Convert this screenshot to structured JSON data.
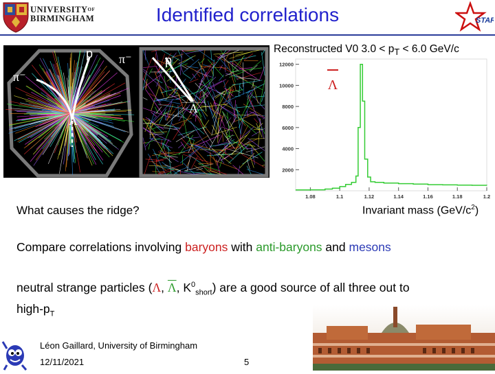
{
  "header": {
    "university_line1": "UNIVERSITY",
    "university_of": "OF",
    "university_line2": "BIRMINGHAM",
    "title": "Identified correlations"
  },
  "event_display": {
    "labels": {
      "p_left": "p",
      "pi_top": "π⁻",
      "pi_left": "π⁻",
      "lambda_left": "Λ",
      "p_right": "p",
      "lambda_right": "Λ"
    }
  },
  "histogram": {
    "caption": "Reconstructed V0 3.0 < pT < 6.0 GeV/c",
    "caption_parts": {
      "pre": "Reconstructed V0 3.0 < p",
      "sub": "T",
      "post": " < 6.0 GeV/c"
    },
    "marker": "Λ",
    "xlabel": "Invariant mass (GeV/c2)",
    "xlabel_parts": {
      "pre": "Invariant mass (GeV/c",
      "sup": "2",
      "post": ")"
    }
  },
  "chart_data": {
    "type": "line",
    "xlim": [
      1.07,
      1.2
    ],
    "ylim": [
      0,
      12500
    ],
    "xticks": [
      1.08,
      1.1,
      1.12,
      1.14,
      1.16,
      1.18,
      1.2
    ],
    "xtick_labels": [
      "1.08",
      "1.1",
      "1.12",
      "1.14",
      "1.16",
      "1.18",
      "1.2"
    ],
    "yticks": [
      2000,
      4000,
      6000,
      8000,
      10000,
      12000
    ],
    "ytick_labels": [
      "2000",
      "4000",
      "6000",
      "8000",
      "10000",
      "12000"
    ],
    "x": [
      1.07,
      1.08,
      1.09,
      1.095,
      1.1,
      1.104,
      1.108,
      1.111,
      1.1125,
      1.114,
      1.1155,
      1.117,
      1.119,
      1.121,
      1.124,
      1.13,
      1.14,
      1.15,
      1.16,
      1.17,
      1.18,
      1.19,
      1.2
    ],
    "y": [
      80,
      90,
      160,
      250,
      400,
      600,
      800,
      1400,
      6000,
      12000,
      8500,
      3000,
      1300,
      850,
      800,
      730,
      680,
      640,
      580,
      560,
      540,
      520,
      500
    ],
    "color": "#33cc33"
  },
  "body": {
    "ridge_question": "What causes the ridge?",
    "compare": {
      "pre": "Compare correlations involving ",
      "baryons": "baryons",
      "mid1": " with ",
      "anti_baryons": "anti-baryons",
      "mid2": " and ",
      "mesons": "mesons"
    },
    "neutral": {
      "pre": "neutral strange particles (",
      "lambda1": "Λ",
      "comma1": ", ",
      "lambda2": "Λ",
      "comma2": ", K",
      "k0_sup": "0",
      "k0_sub": "short",
      "post": ")  are a good source of all three out to",
      "line2_pre": "high-p",
      "line2_sub": "T"
    }
  },
  "footer": {
    "author": "Léon Gaillard, University of Birmingham",
    "date": "12/11/2021",
    "page": "5"
  },
  "colors": {
    "title": "#2222cc",
    "baryons": "#cc2020",
    "anti_baryons": "#2a9a2a",
    "mesons": "#2b3ab5",
    "histogram_line": "#33cc33"
  }
}
